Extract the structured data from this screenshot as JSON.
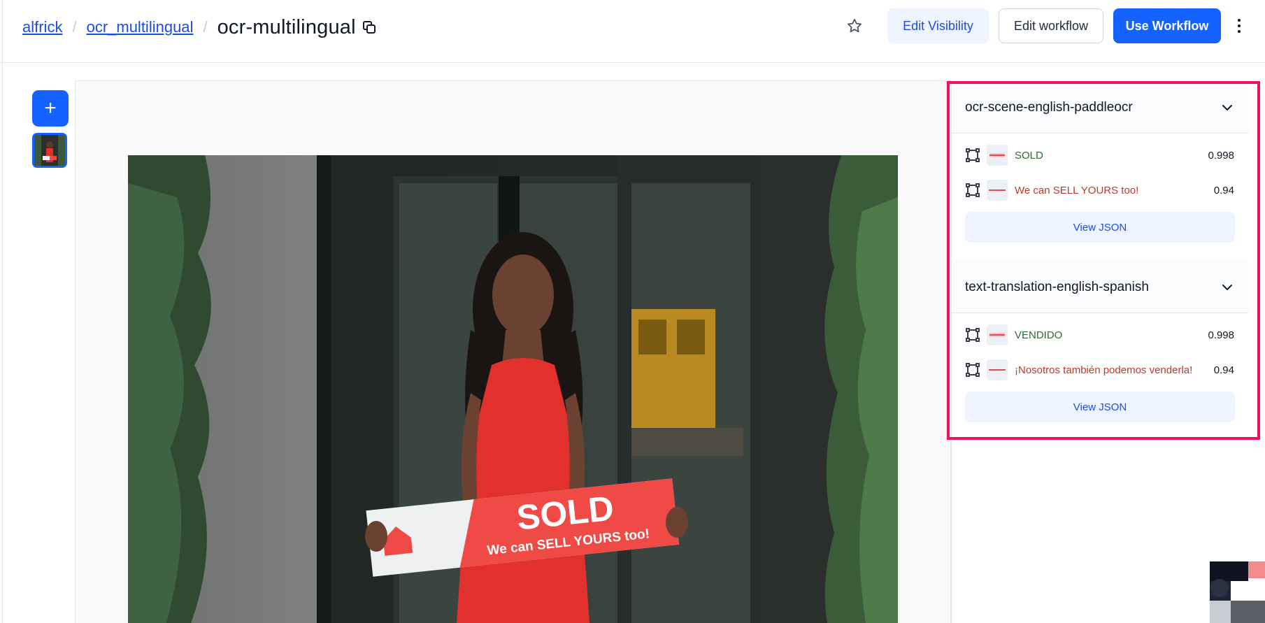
{
  "breadcrumb": {
    "user": "alfrick",
    "app": "ocr_multilingual",
    "workflow": "ocr-multilingual",
    "separator": "/"
  },
  "header": {
    "edit_visibility_label": "Edit Visibility",
    "edit_workflow_label": "Edit workflow",
    "use_workflow_label": "Use Workflow",
    "icons": [
      "copy-icon",
      "star-icon",
      "more-vertical-icon"
    ]
  },
  "toolbar": {
    "add_label": "+"
  },
  "sign": {
    "title": "SOLD",
    "subtitle": "We can SELL YOURS too!"
  },
  "panel": {
    "sections": [
      {
        "title": "ocr-scene-english-paddleocr",
        "rows": [
          {
            "text": "SOLD",
            "score": "0.998",
            "color": "#2f6b2f"
          },
          {
            "text": "We can SELL YOURS too!",
            "score": "0.94",
            "color": "#c0392b"
          }
        ],
        "view_json_label": "View JSON"
      },
      {
        "title": "text-translation-english-spanish",
        "rows": [
          {
            "text": "VENDIDO",
            "score": "0.998",
            "color": "#2f6b2f"
          },
          {
            "text": "¡Nosotros también podemos venderla!",
            "score": "0.94",
            "color": "#c0392b"
          }
        ],
        "view_json_label": "View JSON"
      }
    ]
  },
  "colors": {
    "primary": "#1463ff",
    "highlight_border": "#f0135a",
    "link": "#1d4ed8"
  }
}
